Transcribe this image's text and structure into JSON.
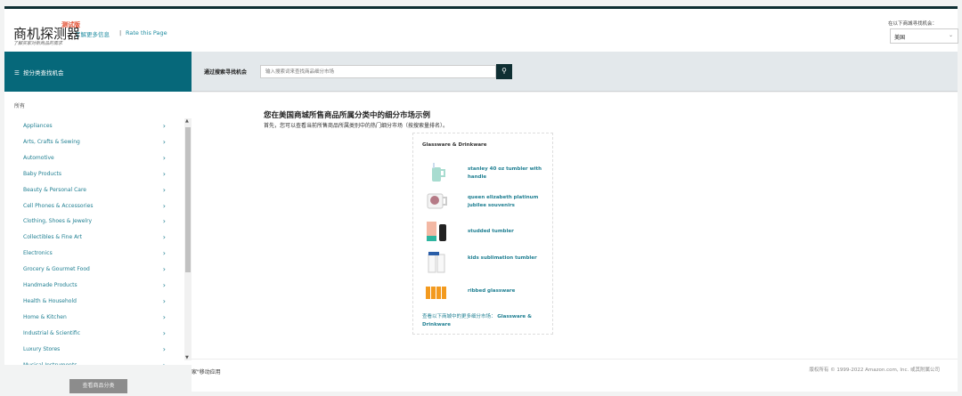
{
  "header": {
    "logo": "商机探测器",
    "logo_badge": "测试版",
    "learn_more": "了解更多信息",
    "separator": "|",
    "rate_page": "Rate this Page",
    "subtitle": "了解买家对新商品的需求",
    "marketplace_label": "在以下商城寻找机会：",
    "marketplace_value": "美国"
  },
  "sidebar": {
    "title": "按分类查找机会",
    "all_label": "所有",
    "items": [
      "Appliances",
      "Arts, Crafts & Sewing",
      "Automotive",
      "Baby Products",
      "Beauty & Personal Care",
      "Cell Phones & Accessories",
      "Clothing, Shoes & Jewelry",
      "Collectibles & Fine Art",
      "Electronics",
      "Grocery & Gourmet Food",
      "Handmade Products",
      "Health & Household",
      "Home & Kitchen",
      "Industrial & Scientific",
      "Luxury Stores",
      "Musical Instruments"
    ],
    "view_button": "查看商品分类"
  },
  "search": {
    "label": "通过搜索寻找机会",
    "placeholder": "输入搜索词来查找商品细分市场"
  },
  "main": {
    "heading": "您在美国商城所售商品所属分类中的细分市场示例",
    "intro": "首先，您可以查看当前所售商品所属类别中的热门细分市场（按搜索量排名）。",
    "card": {
      "title": "Glassware & Drinkware",
      "items": [
        {
          "label": "stanley 40 oz tumbler with handle",
          "icon": "teal-tumbler-image"
        },
        {
          "label": "queen elizabeth platinum jubilee souvenirs",
          "icon": "mug-image"
        },
        {
          "label": "studded tumbler",
          "icon": "tumbler-box-image"
        },
        {
          "label": "kids sublimation tumbler",
          "icon": "sublimation-tumbler-image"
        },
        {
          "label": "ribbed glassware",
          "icon": "ribbed-glasses-image"
        }
      ],
      "more_prefix": "查看以下商城中的更多细分市场：",
      "more_category": "Glassware & Drinkware"
    }
  },
  "footer": {
    "app": "家\"移动应用",
    "copyright": "版权所有 © 1999-2022 Amazon.com, Inc. 或其附属公司"
  },
  "colors": {
    "teal": "#06687a",
    "link": "#1f7f92",
    "dark": "#0f2f33"
  }
}
